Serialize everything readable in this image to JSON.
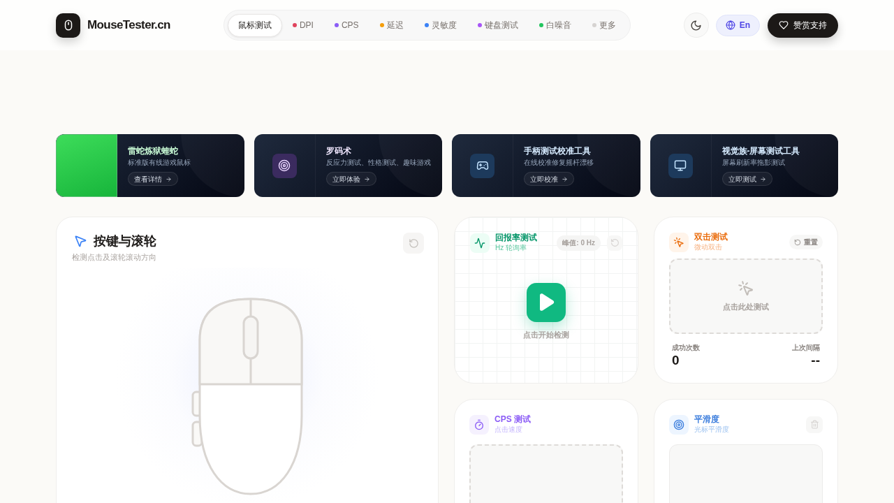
{
  "header": {
    "logo_text": "MouseTester.cn",
    "nav": [
      {
        "label": "鼠标测试",
        "selected": true
      },
      {
        "label": "DPI",
        "selected": false,
        "color": "#e0445e"
      },
      {
        "label": "CPS",
        "selected": false,
        "color": "#8b5cf6"
      },
      {
        "label": "延迟",
        "selected": false,
        "color": "#f59e0b"
      },
      {
        "label": "灵敏度",
        "selected": false,
        "color": "#3b82f6"
      },
      {
        "label": "键盘测试",
        "selected": false,
        "color": "#a855f7"
      },
      {
        "label": "白噪音",
        "selected": false,
        "color": "#22c55e"
      },
      {
        "label": "更多",
        "selected": false,
        "color": "#d6d3d1"
      }
    ],
    "language_button": "En",
    "support_button": "赞赏支持"
  },
  "promos": [
    {
      "kind": "photo",
      "title": "雷蛇炼狱蝰蛇",
      "subtitle": "标准版有线游戏鼠标",
      "button": "查看详情"
    },
    {
      "kind": "target",
      "title": "罗码术",
      "subtitle": "反应力测试、性格测试、趣味游戏",
      "button": "立即体验"
    },
    {
      "kind": "gamepad",
      "title": "手柄测试校准工具",
      "subtitle": "在线校准修复摇杆漂移",
      "button": "立即校准"
    },
    {
      "kind": "monitor",
      "title": "视觉族-屏幕测试工具",
      "subtitle": "屏幕刷新率拖影测试",
      "button": "立即测试"
    }
  ],
  "buttons_panel": {
    "title": "按键与滚轮",
    "subtitle": "检测点击及滚轮滚动方向"
  },
  "polling_rate": {
    "title": "回报率测试",
    "subtitle": "Hz 轮询率",
    "peak_badge": "峰值: 0 Hz",
    "start_label": "点击开始检测"
  },
  "double_click": {
    "title": "双击测试",
    "subtitle": "微动双击",
    "reset_button": "重置",
    "area_prompt": "点击此处测试",
    "stats": [
      {
        "label": "成功次数",
        "value": "0"
      },
      {
        "label": "上次间隔",
        "value": "--"
      }
    ]
  },
  "cps": {
    "title": "CPS 测试",
    "subtitle": "点击速度"
  },
  "smoothness": {
    "title": "平滑度",
    "subtitle": "光标平滑度"
  }
}
